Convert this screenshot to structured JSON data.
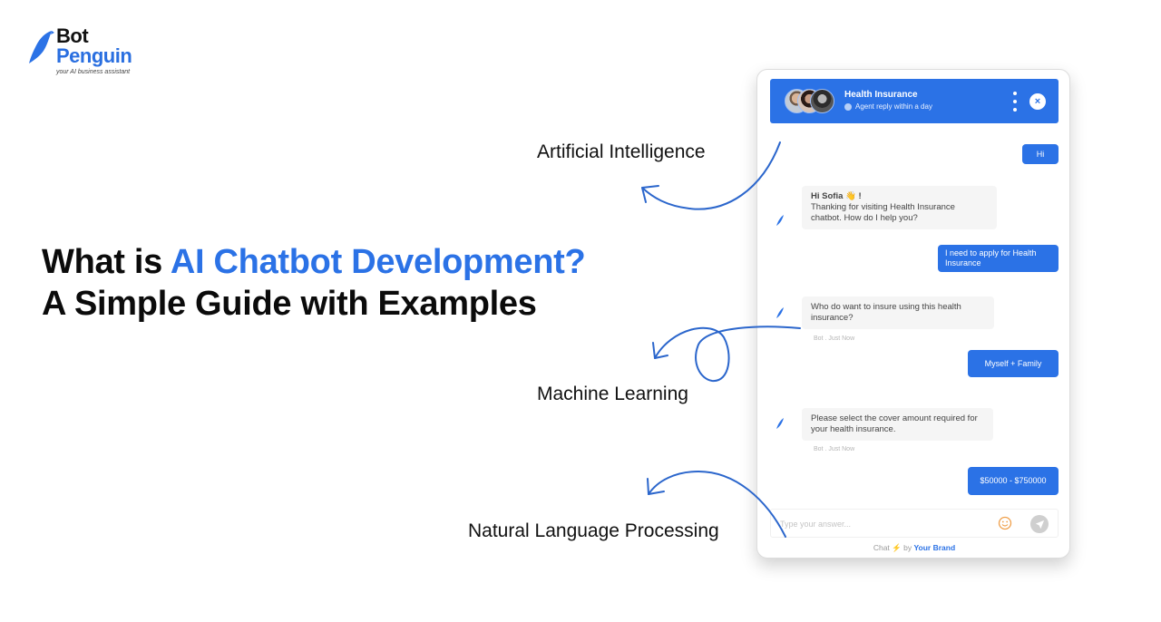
{
  "logo": {
    "line1": "Bot",
    "line2": "Penguin",
    "tagline": "your AI business assistant"
  },
  "headline": {
    "part1": "What is ",
    "accent": "AI Chatbot Development?",
    "part2": " A Simple Guide with Examples"
  },
  "topics": {
    "ai": "Artificial Intelligence",
    "ml": "Machine Learning",
    "nlp": "Natural Language Processing"
  },
  "chat": {
    "header": {
      "title": "Health Insurance",
      "subtitle": "Agent reply within a day",
      "close_icon": "×"
    },
    "messages": [
      {
        "from": "user",
        "text": "Hi"
      },
      {
        "from": "bot",
        "title": "Hi Sofia 👋 !",
        "text": "Thanking for visiting Health Insurance chatbot. How do I help you?"
      },
      {
        "from": "user",
        "text": "I need to apply for Health Insurance"
      },
      {
        "from": "bot",
        "text": "Who do want to insure using this health insurance?",
        "meta": "Bot . Just Now"
      },
      {
        "from": "user",
        "text": "Myself + Family"
      },
      {
        "from": "bot",
        "text": "Please select the cover amount required for your health insurance.",
        "meta": "Bot . Just Now"
      },
      {
        "from": "user",
        "text": "$50000 - $750000"
      }
    ],
    "composer": {
      "placeholder": "Type your answer..."
    },
    "footer": {
      "chat": "Chat",
      "bolt": "⚡",
      "by": "by",
      "brand": "Your Brand"
    }
  },
  "colors": {
    "accent": "#2b72e6",
    "bot_bubble": "#f5f5f5",
    "emoji": "#f0a04b"
  }
}
